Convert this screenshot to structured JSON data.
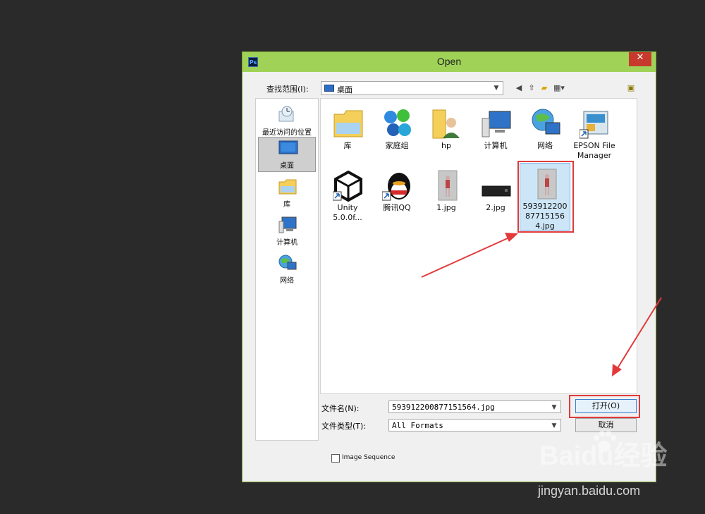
{
  "window": {
    "title": "Open",
    "app_badge": "Ps"
  },
  "toolbar": {
    "look_in_label": "查找范围(I):",
    "look_in_value": "桌面"
  },
  "places": [
    {
      "label": "最近访问的位置",
      "icon": "recent-places-icon"
    },
    {
      "label": "桌面",
      "icon": "desktop-icon",
      "selected": true
    },
    {
      "label": "库",
      "icon": "library-icon"
    },
    {
      "label": "计算机",
      "icon": "computer-icon"
    },
    {
      "label": "网络",
      "icon": "network-icon"
    }
  ],
  "files": [
    {
      "label": "库",
      "icon": "library-icon"
    },
    {
      "label": "家庭组",
      "icon": "homegroup-icon"
    },
    {
      "label": "hp",
      "icon": "user-folder-icon"
    },
    {
      "label": "计算机",
      "icon": "computer-icon"
    },
    {
      "label": "网络",
      "icon": "network-icon"
    },
    {
      "label": "EPSON File Manager",
      "icon": "epson-shortcut-icon"
    },
    {
      "label": "Unity 5.0.0f...",
      "icon": "unity-shortcut-icon"
    },
    {
      "label": "腾讯QQ",
      "icon": "qq-shortcut-icon"
    },
    {
      "label": "1.jpg",
      "icon": "image-thumb-icon"
    },
    {
      "label": "2.jpg",
      "icon": "image-thumb-dark-icon"
    },
    {
      "label": "593912200877151564.jpg",
      "icon": "image-thumb-icon",
      "selected": true
    }
  ],
  "filename": {
    "label": "文件名(N):",
    "value": "593912200877151564.jpg"
  },
  "filetype": {
    "label": "文件类型(T):",
    "value": "All Formats"
  },
  "buttons": {
    "open": "打开(O)",
    "cancel": "取消"
  },
  "image_sequence": {
    "label": "Image Sequence",
    "checked": false
  },
  "watermark": {
    "brand": "Baidu经验",
    "url": "jingyan.baidu.com"
  },
  "colors": {
    "titlebar": "#9fd257",
    "annotation": "#e23a3a",
    "close": "#c7392c"
  }
}
